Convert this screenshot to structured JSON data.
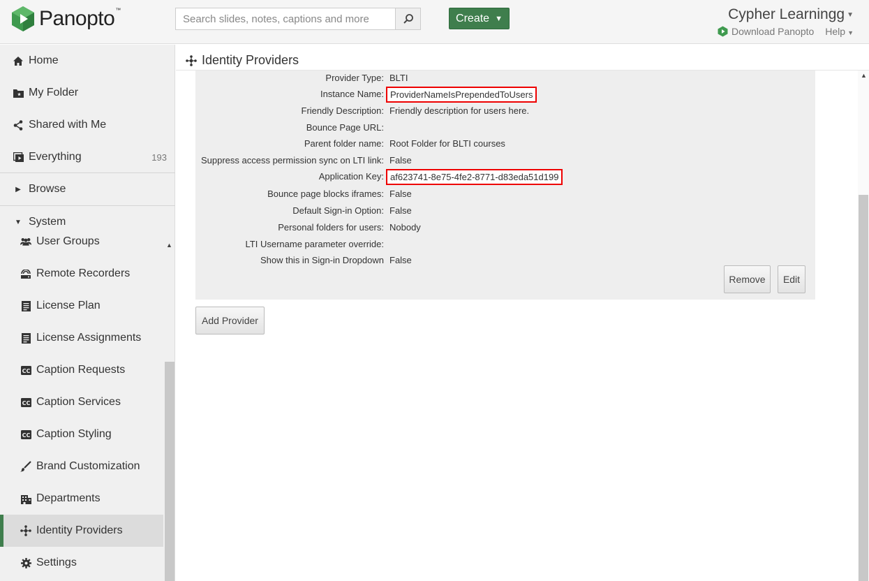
{
  "header": {
    "logo_text": "Panopto",
    "logo_tm": "™",
    "search_placeholder": "Search slides, notes, captions and more",
    "create_label": "Create",
    "user_name": "Cypher Learningg",
    "download_label": "Download Panopto",
    "help_label": "Help"
  },
  "sidebar": {
    "home": "Home",
    "my_folder": "My Folder",
    "shared": "Shared with Me",
    "everything": "Everything",
    "everything_count": "193",
    "browse": "Browse",
    "system": "System",
    "system_items": [
      {
        "label": "User Groups",
        "icon": "user-groups-icon"
      },
      {
        "label": "Remote Recorders",
        "icon": "remote-recorder-icon"
      },
      {
        "label": "License Plan",
        "icon": "document-icon"
      },
      {
        "label": "License Assignments",
        "icon": "document-icon"
      },
      {
        "label": "Caption Requests",
        "icon": "cc-icon"
      },
      {
        "label": "Caption Services",
        "icon": "cc-icon"
      },
      {
        "label": "Caption Styling",
        "icon": "cc-icon"
      },
      {
        "label": "Brand Customization",
        "icon": "brush-icon"
      },
      {
        "label": "Departments",
        "icon": "building-icon"
      },
      {
        "label": "Identity Providers",
        "icon": "identity-icon"
      },
      {
        "label": "Settings",
        "icon": "gear-icon"
      }
    ]
  },
  "main": {
    "title": "Identity Providers",
    "fields": [
      {
        "label": "Provider Type:",
        "value": "BLTI",
        "highlight": false
      },
      {
        "label": "Instance Name:",
        "value": "ProviderNameIsPrependedToUsers",
        "highlight": true
      },
      {
        "label": "Friendly Description:",
        "value": "Friendly description for users here.",
        "highlight": false
      },
      {
        "label": "Bounce Page URL:",
        "value": "",
        "highlight": false
      },
      {
        "label": "Parent folder name:",
        "value": "Root Folder for BLTI courses",
        "highlight": false
      },
      {
        "label": "Suppress access permission sync on LTI link:",
        "value": "False",
        "highlight": false
      },
      {
        "label": "Application Key:",
        "value": "af623741-8e75-4fe2-8771-d83eda51d199",
        "highlight": true
      },
      {
        "label": "Bounce page blocks iframes:",
        "value": "False",
        "highlight": false
      },
      {
        "label": "Default Sign-in Option:",
        "value": "False",
        "highlight": false
      },
      {
        "label": "Personal folders for users:",
        "value": "Nobody",
        "highlight": false
      },
      {
        "label": "LTI Username parameter override:",
        "value": "",
        "highlight": false
      },
      {
        "label": "Show this in Sign-in Dropdown",
        "value": "False",
        "highlight": false
      }
    ],
    "remove_label": "Remove",
    "edit_label": "Edit",
    "add_provider_label": "Add Provider"
  },
  "colors": {
    "accent": "#3f7e4d",
    "highlight_border": "#e00000"
  }
}
